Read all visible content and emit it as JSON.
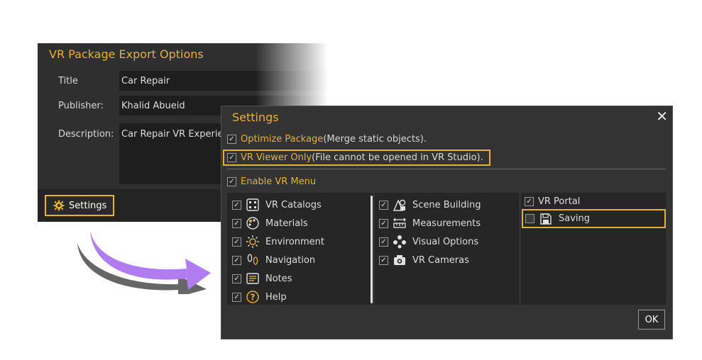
{
  "export_dialog": {
    "title": "VR Package Export Options",
    "fields": {
      "title_label": "Title",
      "title_value": "Car Repair",
      "publisher_label": "Publisher:",
      "publisher_value": "Khalid Abueid",
      "description_label": "Description:",
      "description_value": "Car Repair VR Experie"
    },
    "settings_button": "Settings"
  },
  "settings_dialog": {
    "title": "Settings",
    "close_icon": "close-icon",
    "optimize": {
      "label": "Optimize Package",
      "note": "(Merge static objects).",
      "checked": true
    },
    "viewer_only": {
      "label": "VR Viewer Only",
      "note": "(File cannot be opened in VR Studio).",
      "checked": true
    },
    "enable_menu": {
      "label": "Enable VR Menu",
      "checked": true
    },
    "column1": [
      {
        "label": "VR Catalogs",
        "icon": "catalog-grid-icon",
        "checked": true
      },
      {
        "label": "Materials",
        "icon": "palette-icon",
        "checked": true
      },
      {
        "label": "Environment",
        "icon": "sun-icon",
        "checked": true
      },
      {
        "label": "Navigation",
        "icon": "footprints-icon",
        "checked": true
      },
      {
        "label": "Notes",
        "icon": "notes-icon",
        "checked": true
      },
      {
        "label": "Help",
        "icon": "help-icon",
        "checked": true
      }
    ],
    "column2": [
      {
        "label": "Scene Building",
        "icon": "scene-building-icon",
        "checked": true
      },
      {
        "label": "Measurements",
        "icon": "ruler-icon",
        "checked": true
      },
      {
        "label": "Visual Options",
        "icon": "visual-options-icon",
        "checked": true
      },
      {
        "label": "VR Cameras",
        "icon": "camera-icon",
        "checked": true
      }
    ],
    "column3": [
      {
        "label": "VR Portal",
        "checked": true
      },
      {
        "label": "Saving",
        "icon": "save-icon",
        "checked": false
      }
    ],
    "ok_button": "OK"
  },
  "colors": {
    "accent": "#e7b12f",
    "dialog_bg": "#333333",
    "panel_bg": "#262626",
    "arrow": "#b07cf0"
  }
}
